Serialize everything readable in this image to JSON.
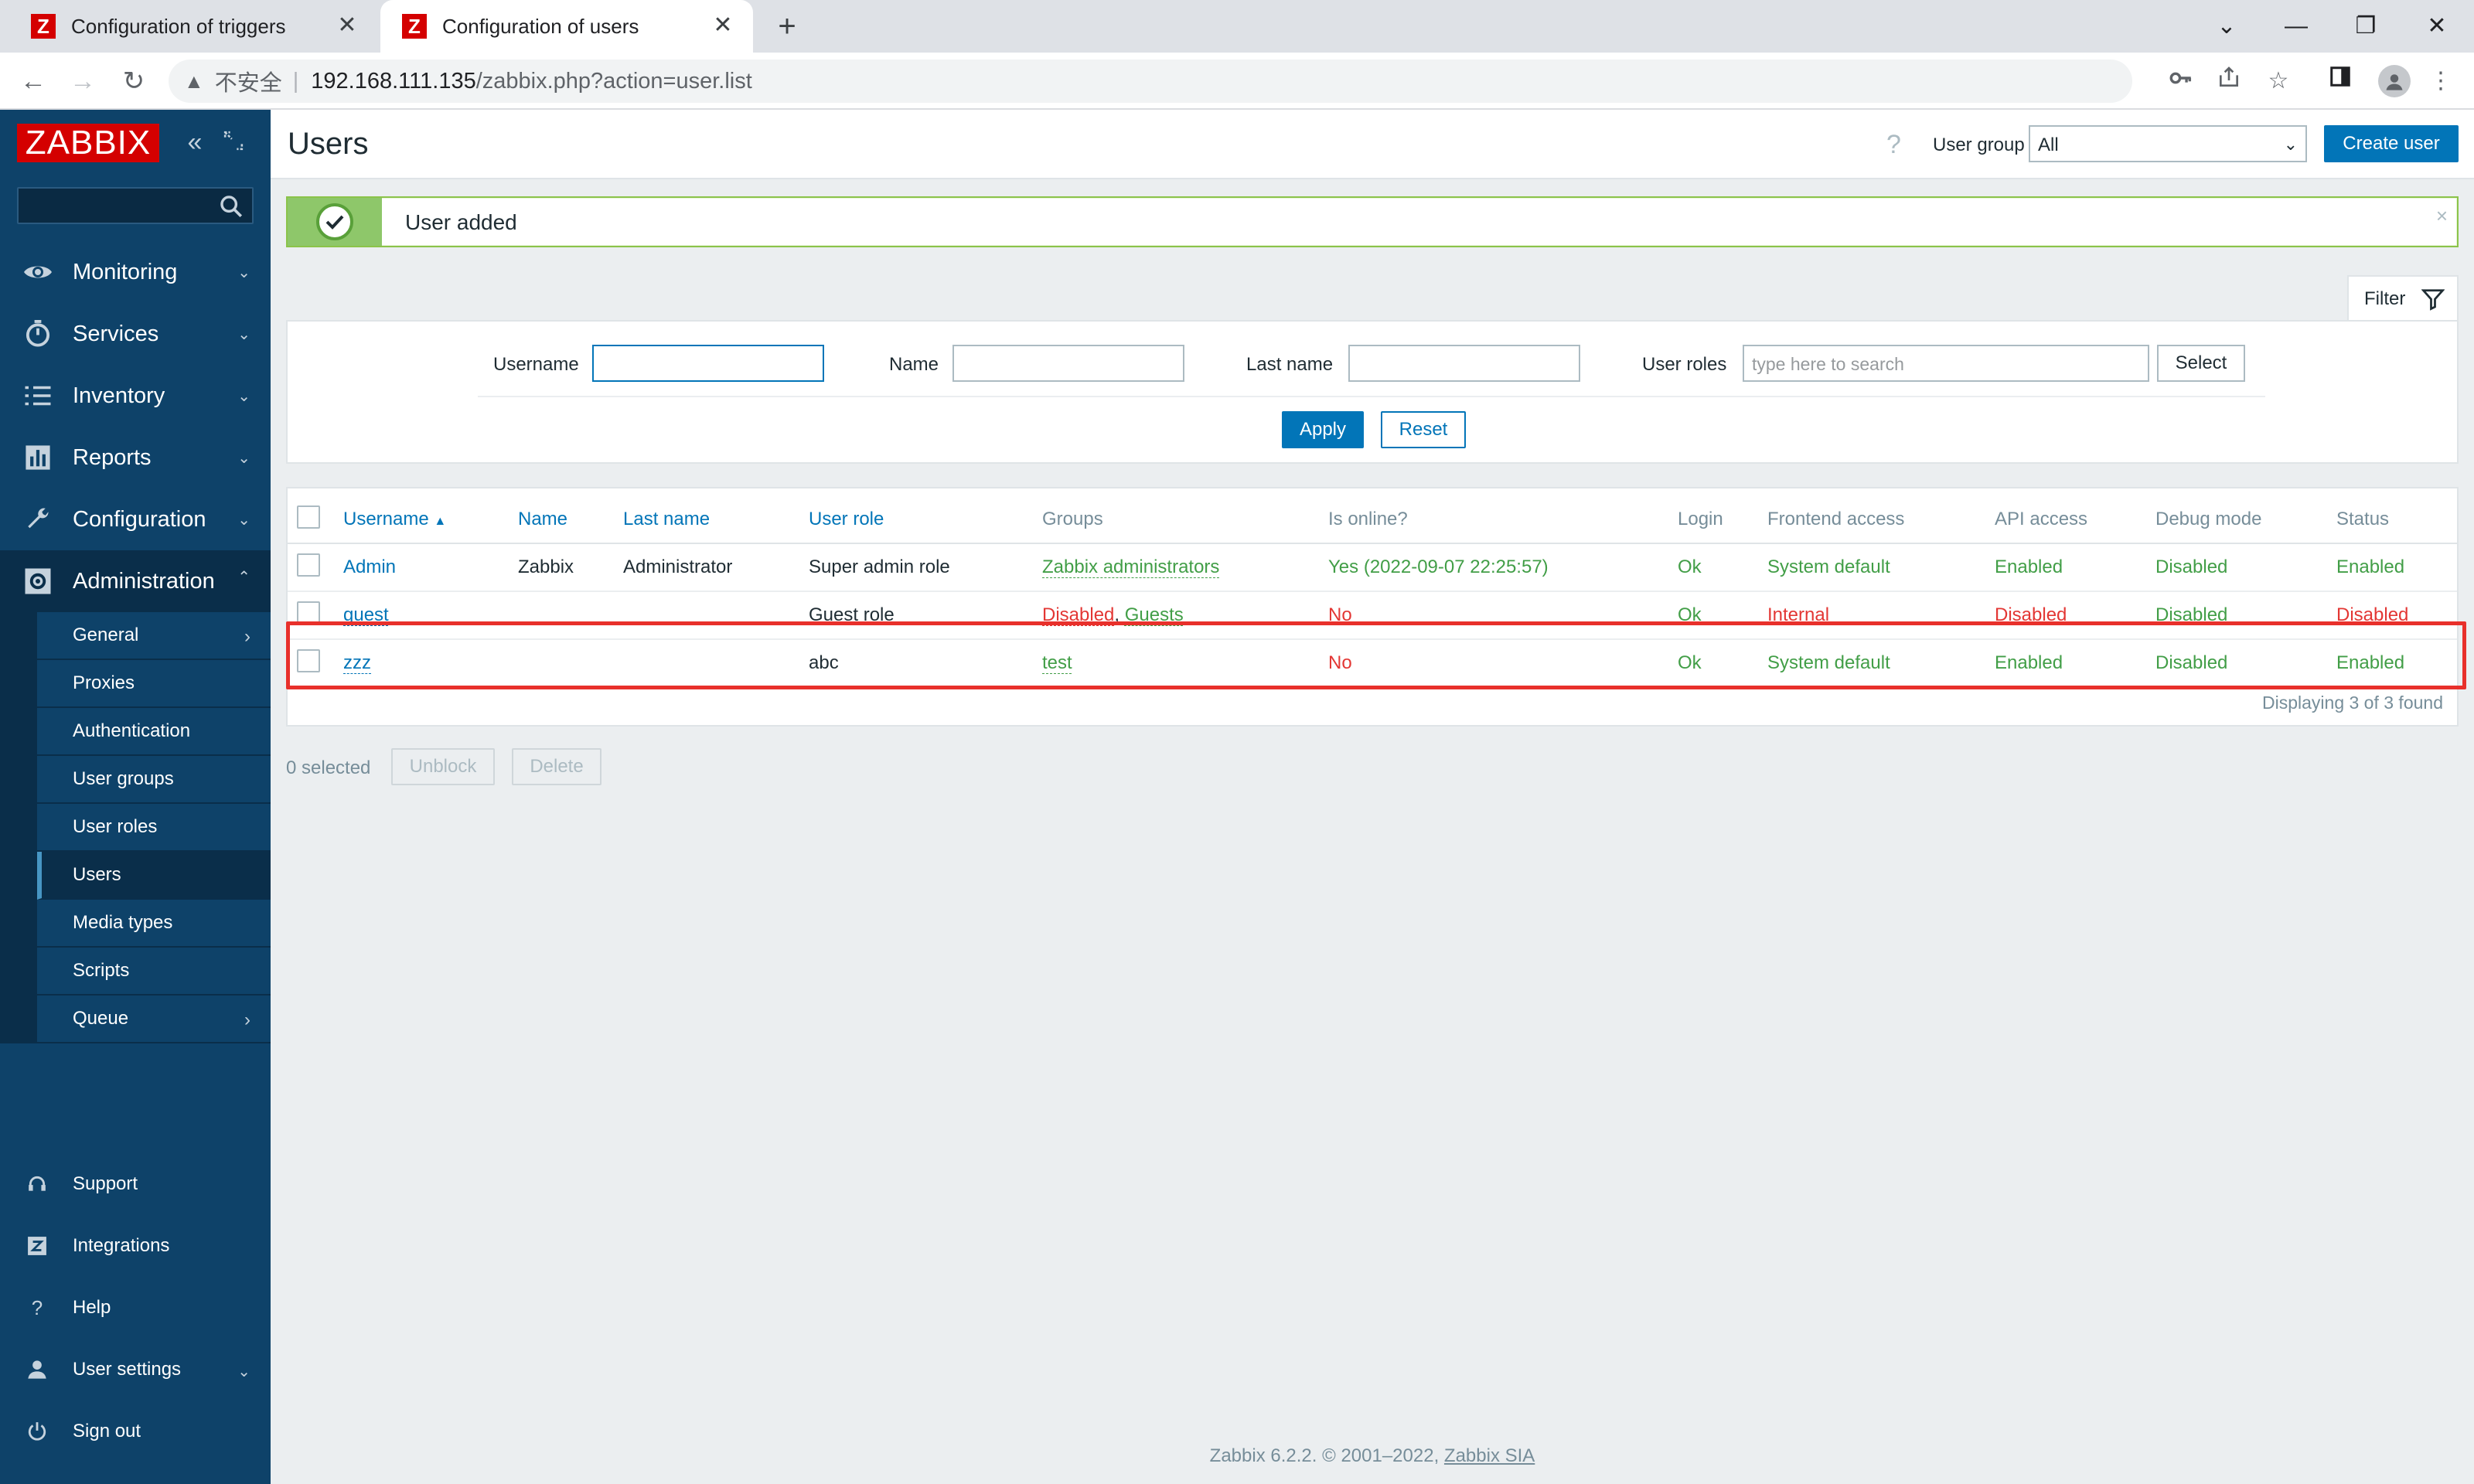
{
  "browser": {
    "tabs": [
      {
        "title": "Configuration of triggers"
      },
      {
        "title": "Configuration of users"
      }
    ],
    "url": {
      "security": "不安全",
      "host": "192.168.111.135",
      "path": "/zabbix.php?action=user.list"
    }
  },
  "sidebar": {
    "logo": "ZABBIX",
    "search_placeholder": "",
    "menu": [
      {
        "label": "Monitoring",
        "icon": "eye-icon"
      },
      {
        "label": "Services",
        "icon": "stopwatch-icon"
      },
      {
        "label": "Inventory",
        "icon": "list-icon"
      },
      {
        "label": "Reports",
        "icon": "bar-chart-icon"
      },
      {
        "label": "Configuration",
        "icon": "wrench-icon"
      },
      {
        "label": "Administration",
        "icon": "gear-icon"
      }
    ],
    "admin_submenu": [
      {
        "label": "General"
      },
      {
        "label": "Proxies"
      },
      {
        "label": "Authentication"
      },
      {
        "label": "User groups"
      },
      {
        "label": "User roles"
      },
      {
        "label": "Users"
      },
      {
        "label": "Media types"
      },
      {
        "label": "Scripts"
      },
      {
        "label": "Queue"
      }
    ],
    "bottom": [
      {
        "label": "Support",
        "icon": "headset-icon"
      },
      {
        "label": "Integrations",
        "icon": "zabbix-z-icon"
      },
      {
        "label": "Help",
        "icon": "question-icon"
      },
      {
        "label": "User settings",
        "icon": "user-icon"
      },
      {
        "label": "Sign out",
        "icon": "power-icon"
      }
    ]
  },
  "header": {
    "title": "Users",
    "help": "?",
    "user_group_label": "User group",
    "user_group_value": "All",
    "create_button": "Create user"
  },
  "message": {
    "text": "User added",
    "close": "×"
  },
  "filter": {
    "tab_label": "Filter",
    "username_label": "Username",
    "username_value": "",
    "name_label": "Name",
    "name_value": "",
    "lastname_label": "Last name",
    "lastname_value": "",
    "roles_label": "User roles",
    "roles_placeholder": "type here to search",
    "select_button": "Select",
    "apply_button": "Apply",
    "reset_button": "Reset"
  },
  "table": {
    "columns": {
      "username": "Username",
      "name": "Name",
      "lastname": "Last name",
      "role": "User role",
      "groups": "Groups",
      "online": "Is online?",
      "login": "Login",
      "frontend": "Frontend access",
      "api": "API access",
      "debug": "Debug mode",
      "status": "Status"
    },
    "sort_indicator": "▲",
    "rows": [
      {
        "username": "Admin",
        "name": "Zabbix",
        "lastname": "Administrator",
        "role": "Super admin role",
        "group1": "Zabbix administrators",
        "group_sep": "",
        "group2": "",
        "online": "Yes (2022-09-07 22:25:57)",
        "login": "Ok",
        "frontend": "System default",
        "api": "Enabled",
        "debug": "Disabled",
        "status": "Enabled"
      },
      {
        "username": "guest",
        "name": "",
        "lastname": "",
        "role": "Guest role",
        "group1": "Disabled",
        "group_sep": ", ",
        "group2": "Guests",
        "online": "No",
        "login": "Ok",
        "frontend": "Internal",
        "api": "Disabled",
        "debug": "Disabled",
        "status": "Disabled"
      },
      {
        "username": "zzz",
        "name": "",
        "lastname": "",
        "role": "abc",
        "group1": "test",
        "group_sep": "",
        "group2": "",
        "online": "No",
        "login": "Ok",
        "frontend": "System default",
        "api": "Enabled",
        "debug": "Disabled",
        "status": "Enabled"
      }
    ],
    "display_count": "Displaying 3 of 3 found"
  },
  "actions": {
    "selected": "0 selected",
    "unblock": "Unblock",
    "delete": "Delete"
  },
  "footer": {
    "text": "Zabbix 6.2.2. © 2001–2022,",
    "link": "Zabbix SIA"
  }
}
